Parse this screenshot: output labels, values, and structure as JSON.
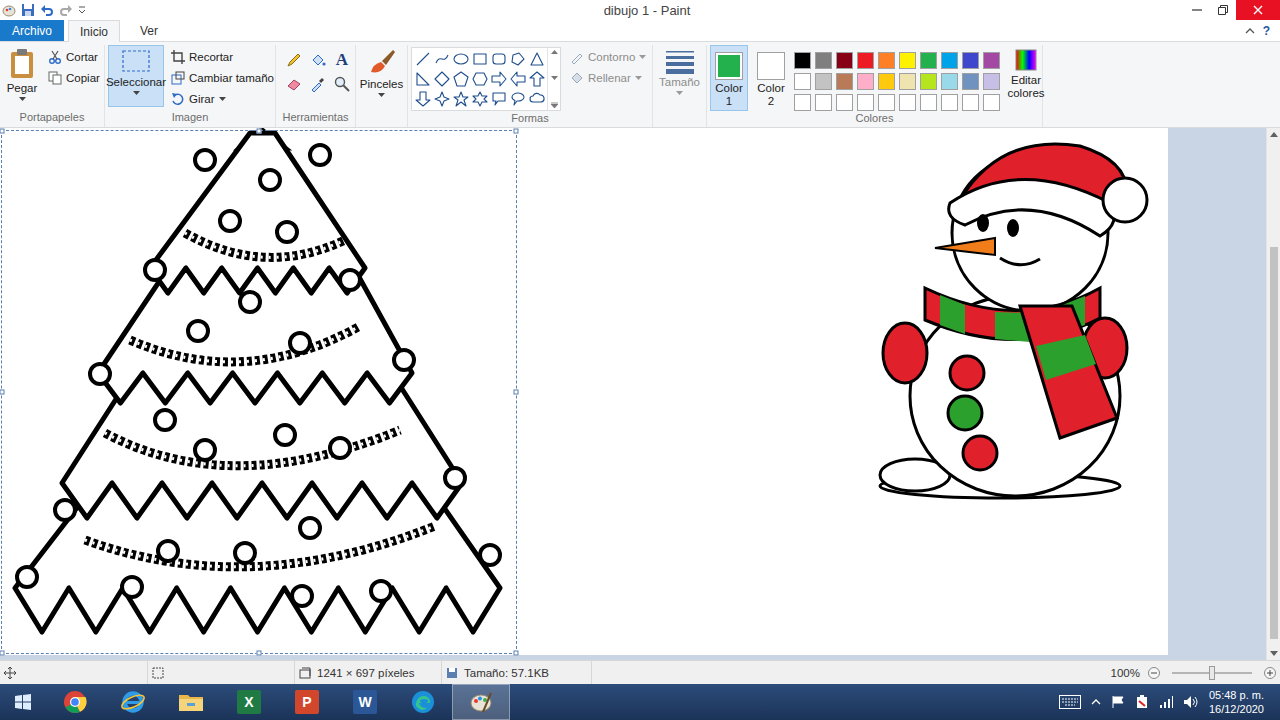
{
  "window": {
    "title": "dibujo 1 - Paint"
  },
  "menu_tabs": [
    {
      "label": "Archivo",
      "kind": "file",
      "selected": false
    },
    {
      "label": "Inicio",
      "kind": "tab",
      "selected": true
    },
    {
      "label": "Ver",
      "kind": "tab",
      "selected": false
    }
  ],
  "help": "?",
  "ribbon": {
    "clipboard": {
      "title": "Portapapeles",
      "paste": "Pegar",
      "actions": [
        "Cortar",
        "Copiar"
      ]
    },
    "image": {
      "title": "Imagen",
      "select": {
        "label": "Seleccionar",
        "selected": true
      },
      "actions": [
        "Recortar",
        "Cambiar tamaño",
        "Girar"
      ]
    },
    "tools": {
      "title": "Herramientas",
      "text_tool": "A"
    },
    "brushes": {
      "label": "Pinceles"
    },
    "shapes": {
      "title": "Formas",
      "options": [
        {
          "label": "Contorno",
          "disabled": true
        },
        {
          "label": "Rellenar",
          "disabled": true
        }
      ]
    },
    "size": {
      "label": "Tamaño",
      "disabled": true
    },
    "colors": {
      "title": "Colores",
      "slots": [
        {
          "label": "Color 1",
          "color": "#22b14c",
          "selected": true
        },
        {
          "label": "Color 2",
          "color": "#ffffff",
          "selected": false
        }
      ],
      "palette": [
        "#000000",
        "#7f7f7f",
        "#880015",
        "#ed1c24",
        "#ff7f27",
        "#fff200",
        "#22b14c",
        "#00a2e8",
        "#3f48cc",
        "#a349a4",
        "#ffffff",
        "#c3c3c3",
        "#b97a57",
        "#ffaec9",
        "#ffc90e",
        "#efe4b0",
        "#b5e61d",
        "#99d9ea",
        "#7092be",
        "#c8bfe7",
        "#ffffff",
        "#ffffff",
        "#ffffff",
        "#ffffff",
        "#ffffff",
        "#ffffff",
        "#ffffff",
        "#ffffff",
        "#ffffff",
        "#ffffff"
      ],
      "edit": "Editar colores"
    }
  },
  "canvas": {
    "selection": true
  },
  "status_bar": {
    "dimensions": "1241 × 697 píxeles",
    "file_size": "Tamaño: 57.1KB",
    "zoom": "100%",
    "zoom_level": 0.5
  },
  "taskbar": {
    "apps": [
      {
        "kind": "start",
        "selected": false
      },
      {
        "kind": "chrome",
        "selected": false
      },
      {
        "kind": "ie",
        "selected": false
      },
      {
        "kind": "explorer",
        "selected": false
      },
      {
        "kind": "excel",
        "label": "X",
        "selected": false
      },
      {
        "kind": "powerpoint",
        "label": "P",
        "selected": false
      },
      {
        "kind": "word",
        "label": "W",
        "selected": false
      },
      {
        "kind": "edge",
        "selected": false
      },
      {
        "kind": "paint",
        "selected": true
      }
    ],
    "time": "05:48 p. m.",
    "date": "16/12/2020"
  }
}
